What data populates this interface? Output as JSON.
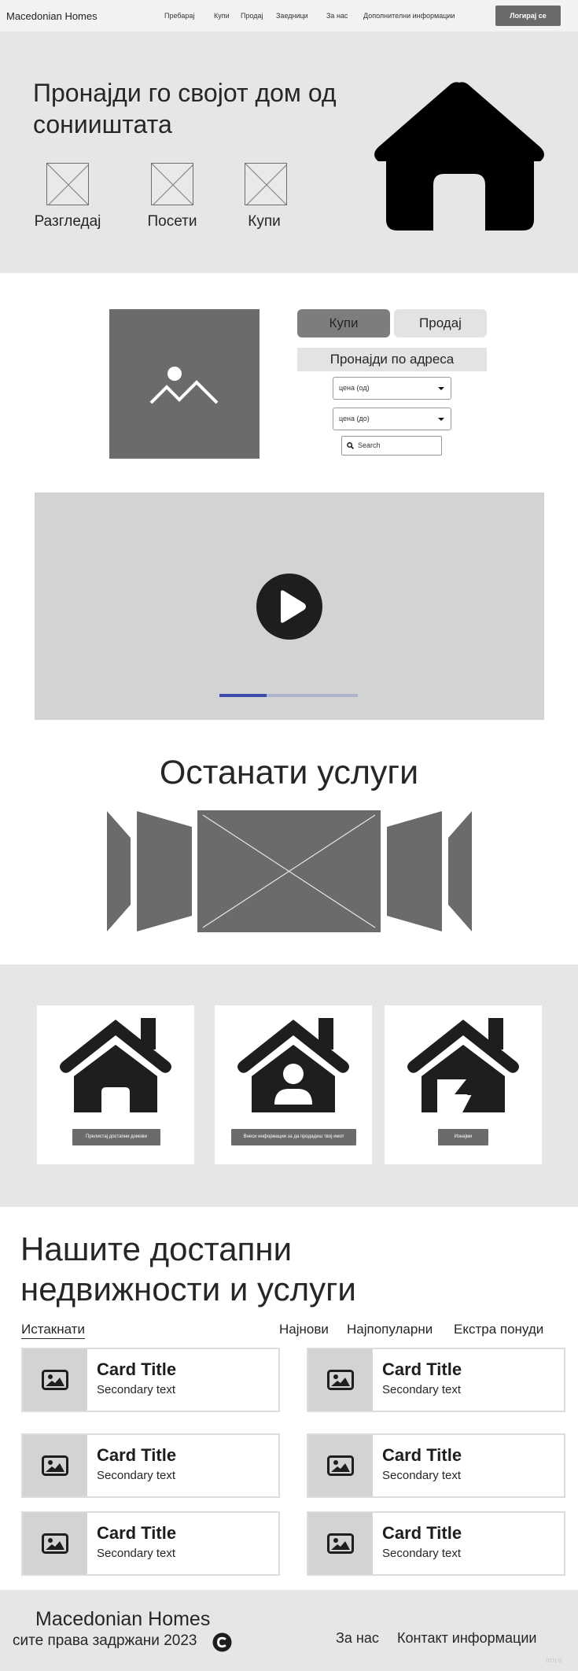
{
  "nav": {
    "brand": "Macedonian Homes",
    "links": [
      "Пребарај",
      "Купи",
      "Продај",
      "Заедници",
      "За нас",
      "Дополнителни информации"
    ],
    "login_label": "Логирај се"
  },
  "hero": {
    "title": "Пронајди го својот дом од сонииштата",
    "actions": [
      "Разгледај",
      "Посети",
      "Купи"
    ],
    "icon": "house-icon"
  },
  "search": {
    "tabs": [
      "Купи",
      "Продај"
    ],
    "active_tab": "Купи",
    "find_label": "Пронајди по адреса",
    "price_from": "цена (од)",
    "price_to": "цена (до)",
    "search_placeholder": "Search"
  },
  "video": {
    "progress": 0.34,
    "icon": "play-icon"
  },
  "services": {
    "title": "Останати услуги"
  },
  "features": {
    "buttons": [
      "Прелистај достапни домови",
      "Внеси информации за да продадеш твој имот",
      "Изнајми"
    ],
    "icons": [
      "house-icon",
      "house-user-icon",
      "house-broken-icon"
    ]
  },
  "listings": {
    "title": "Нашите достапни недвижности и услуги",
    "filters": [
      "Истакнати",
      "Најнови",
      "Најпопуларни",
      "Екстра понуди"
    ],
    "active_filter": "Истакнати",
    "cards": [
      {
        "title": "Card Title",
        "subtitle": "Secondary text"
      },
      {
        "title": "Card Title",
        "subtitle": "Secondary text"
      },
      {
        "title": "Card Title",
        "subtitle": "Secondary text"
      },
      {
        "title": "Card Title",
        "subtitle": "Secondary text"
      },
      {
        "title": "Card Title",
        "subtitle": "Secondary text"
      },
      {
        "title": "Card Title",
        "subtitle": "Secondary text"
      }
    ]
  },
  "footer": {
    "brand": "Macedonian Homes",
    "copyright": "сите права задржани 2023",
    "links": [
      "За нас",
      "Контакт информации"
    ],
    "watermark": "miro"
  },
  "colors": {
    "nav_bg": "#f2f2f2",
    "band_bg": "#e6e6e6",
    "dark_gray": "#6b6b6b",
    "icon_black": "#1e1e1e",
    "progress_fill": "#3c4aa8",
    "progress_track": "#aeb5cd"
  }
}
